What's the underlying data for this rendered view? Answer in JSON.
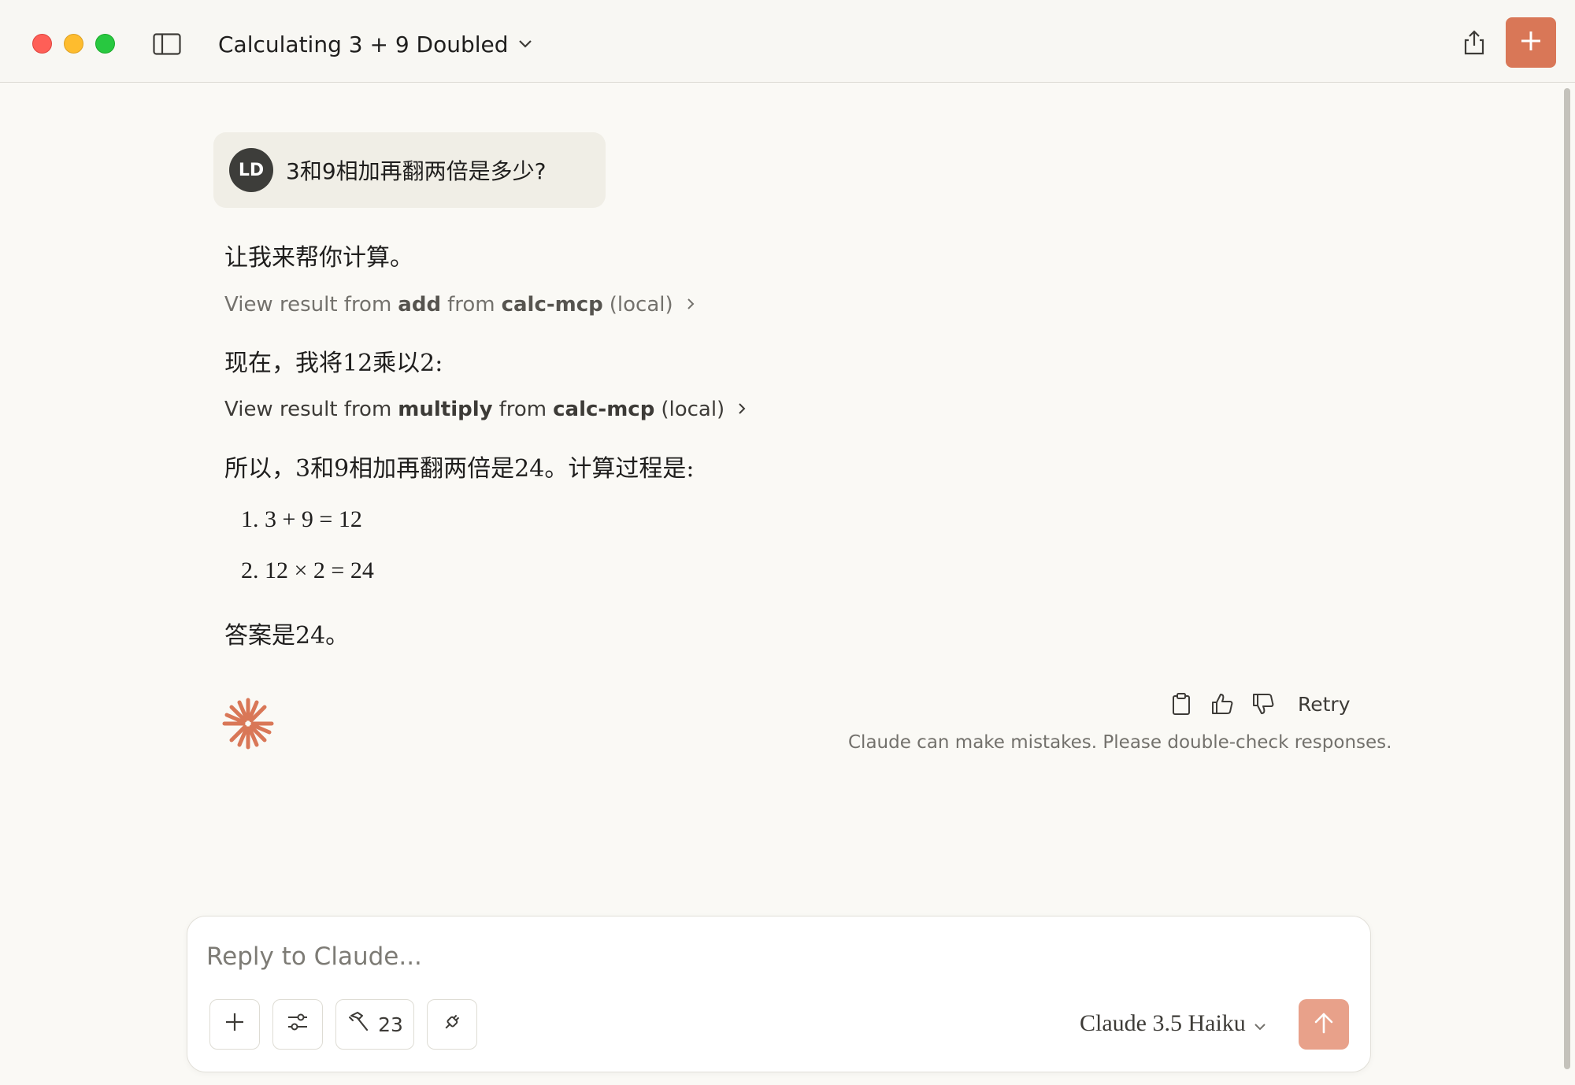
{
  "window": {
    "title": "Calculating 3 + 9 Doubled",
    "icons": [
      "close-dot",
      "minimize-dot",
      "zoom-dot",
      "sidebar-toggle-icon",
      "chevron-down-icon",
      "share-icon",
      "plus-icon"
    ]
  },
  "conversation": {
    "user": {
      "avatar_initials": "LD",
      "message": "3和9相加再翻两倍是多少?"
    },
    "assistant": {
      "intro": "让我来帮你计算。",
      "tool1": {
        "prefix": "View result from",
        "tool": "add",
        "from": "from",
        "server": "calc-mcp",
        "suffix": "(local)"
      },
      "step_text": "现在，我将12乘以2:",
      "tool2": {
        "prefix": "View result from",
        "tool": "multiply",
        "from": "from",
        "server": "calc-mcp",
        "suffix": "(local)"
      },
      "summary": "所以，3和9相加再翻两倍是24。计算过程是:",
      "steps": [
        "1. 3 + 9 = 12",
        "2. 12 × 2 = 24"
      ],
      "answer": "答案是24。"
    },
    "actions": {
      "retry_label": "Retry",
      "disclaimer": "Claude can make mistakes. Please double-check responses.",
      "icons": [
        "copy-icon",
        "thumbs-up-icon",
        "thumbs-down-icon"
      ]
    }
  },
  "composer": {
    "placeholder": "Reply to Claude...",
    "value": "",
    "tools_count": "23",
    "model_label": "Claude 3.5 Haiku",
    "icons": [
      "plus-icon",
      "sliders-icon",
      "hammer-icon",
      "plug-icon",
      "chevron-down-icon",
      "arrow-up-icon"
    ]
  },
  "colors": {
    "accent": "#d97757",
    "send_disabled": "#e8a18a",
    "background": "#faf9f5",
    "bubble": "#f0eee6"
  }
}
